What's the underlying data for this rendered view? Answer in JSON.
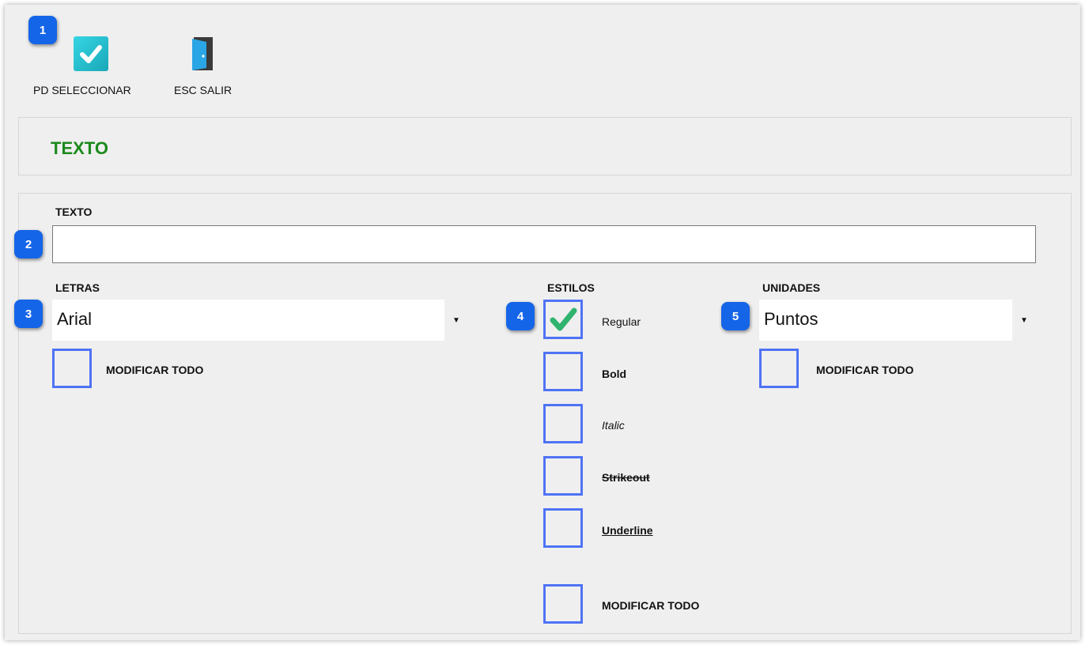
{
  "toolbar": {
    "select_label": "PD SELECCIONAR",
    "exit_label": "ESC SALIR"
  },
  "header": {
    "title": "TEXTO"
  },
  "form": {
    "texto_label": "TEXTO",
    "texto_value": "",
    "letras_label": "LETRAS",
    "letras_value": "Arial",
    "letras_modify_all": "MODIFICAR TODO",
    "estilos_label": "ESTILOS",
    "styles": [
      {
        "label": "Regular",
        "checked": true
      },
      {
        "label": "Bold",
        "checked": false
      },
      {
        "label": "Italic",
        "checked": false
      },
      {
        "label": "Strikeout",
        "checked": false
      },
      {
        "label": "Underline",
        "checked": false
      }
    ],
    "estilos_modify_all": "MODIFICAR TODO",
    "unidades_label": "UNIDADES",
    "unidades_value": "Puntos",
    "unidades_modify_all": "MODIFICAR TODO"
  },
  "badges": [
    "1",
    "2",
    "3",
    "4",
    "5"
  ],
  "colors": {
    "title_green": "#1b8a1b",
    "checkbox_border": "#4f73f5",
    "check_mark": "#2fb36f",
    "badge_blue": "#1565e8"
  },
  "icons": {
    "select": "check-icon",
    "exit": "door-icon",
    "dropdown": "triangle-down-icon"
  }
}
